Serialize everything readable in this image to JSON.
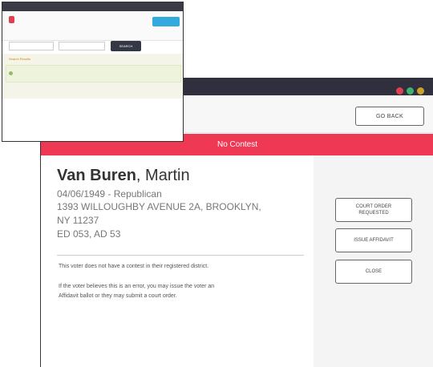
{
  "main": {
    "go_back_label": "GO BACK",
    "banner_text": "No Contest",
    "voter": {
      "last_name": "Van Buren",
      "first_name": ", Martin",
      "dob_party": "04/06/1949 - Republican",
      "address_line1": "1393 WILLOUGHBY AVENUE 2A, BROOKLYN,",
      "address_line2": "NY 11237",
      "district": "ED 053, AD 53"
    },
    "note1": "This voter does not have a contest in their registered district.",
    "note2_line1": "If the voter believes this is an error, you may issue the voter an",
    "note2_line2": "Affidavit ballot or they may submit a court order.",
    "buttons": {
      "court_order_line1": "COURT ORDER",
      "court_order_line2": "REQUESTED",
      "issue_affidavit": "ISSUE AFFIDAVIT",
      "close": "CLOSE"
    },
    "status_dot_colors": [
      "#e04050",
      "#3cb371",
      "#c9a227"
    ],
    "header_tint": "#2f2f3d",
    "banner_color": "#ef3854"
  },
  "inset": {
    "search_button": "SEARCH",
    "results_label": "Search Results"
  }
}
